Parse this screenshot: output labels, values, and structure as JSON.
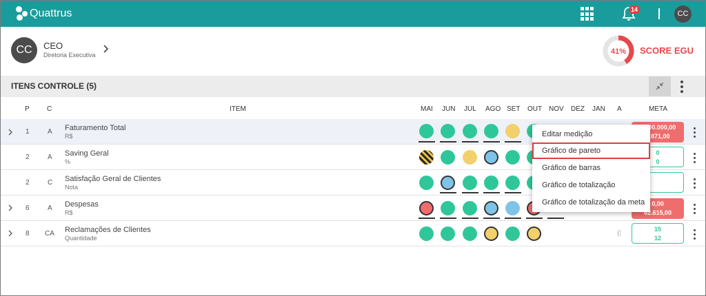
{
  "app": {
    "brand": "Quattrus",
    "notifications": "14",
    "user_initials": "CC"
  },
  "profile": {
    "initials": "CC",
    "role": "CEO",
    "department": "Diretoria Executiva"
  },
  "score": {
    "percent_label": "41%",
    "percent": 41,
    "label": "SCORE EGU",
    "color": "#e8484c"
  },
  "section": {
    "title": "ITENS CONTROLE (5)"
  },
  "columns": {
    "p": "P",
    "c": "C",
    "item": "ITEM",
    "months": [
      "MAI",
      "JUN",
      "JUL",
      "AGO",
      "SET",
      "OUT",
      "NOV",
      "DEZ",
      "JAN",
      "A"
    ],
    "meta": "META"
  },
  "rows": [
    {
      "p": "1",
      "c": "A",
      "name": "Faturamento Total",
      "unit": "R$",
      "meta1": "2.000.000,00",
      "meta2": "1.871,00"
    },
    {
      "p": "2",
      "c": "A",
      "name": "Saving Geral",
      "unit": "%",
      "meta1": "0",
      "meta2": "0"
    },
    {
      "p": "2",
      "c": "C",
      "name": "Satisfação Geral de Clientes",
      "unit": "Nota",
      "meta1": "",
      "meta2": ""
    },
    {
      "p": "6",
      "c": "A",
      "name": "Despesas",
      "unit": "R$",
      "meta1": "0,00",
      "meta2": "62.615,00"
    },
    {
      "p": "8",
      "c": "CA",
      "name": "Reclamações de Clientes",
      "unit": "Quantidade",
      "meta1": "15",
      "meta2": "12"
    }
  ],
  "menu": {
    "items": [
      "Editar medição",
      "Gráfico de pareto",
      "Gráfico de barras",
      "Gráfico de totalização",
      "Gráfico de totalização da meta"
    ],
    "selected_index": 1
  },
  "colors": {
    "topbar": "#1a9c9c",
    "green": "#2fc79a",
    "yellow": "#f2d06b",
    "blue": "#7fc4e8",
    "red": "#ef6d6d"
  }
}
